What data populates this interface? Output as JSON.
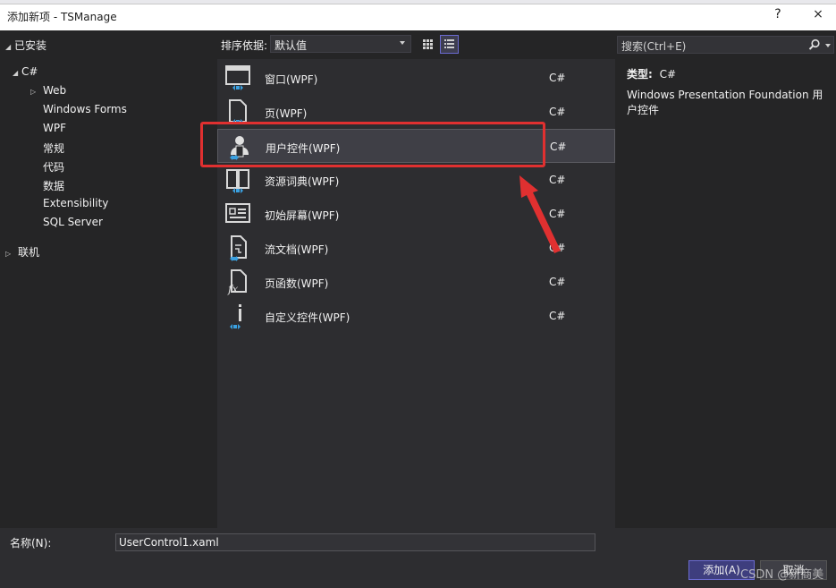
{
  "window": {
    "title": "添加新项 - TSManage",
    "help": "?",
    "close": "×"
  },
  "tree": {
    "installed": "已安装",
    "csharp": "C#",
    "items": [
      "Web",
      "Windows Forms",
      "WPF",
      "常规",
      "代码",
      "数据",
      "Extensibility",
      "SQL Server"
    ],
    "online": "联机"
  },
  "toolbar": {
    "sort_label": "排序依据:",
    "sort_value": "默认值"
  },
  "search": {
    "placeholder": "搜索(Ctrl+E)"
  },
  "templates": [
    {
      "name": "窗口(WPF)",
      "lang": "C#",
      "icon": "wpf-window-icon"
    },
    {
      "name": "页(WPF)",
      "lang": "C#",
      "icon": "wpf-page-icon"
    },
    {
      "name": "用户控件(WPF)",
      "lang": "C#",
      "icon": "wpf-user-control-icon"
    },
    {
      "name": "资源词典(WPF)",
      "lang": "C#",
      "icon": "resource-dictionary-icon"
    },
    {
      "name": "初始屏幕(WPF)",
      "lang": "C#",
      "icon": "splash-screen-icon"
    },
    {
      "name": "流文档(WPF)",
      "lang": "C#",
      "icon": "flow-document-icon"
    },
    {
      "name": "页函数(WPF)",
      "lang": "C#",
      "icon": "page-function-icon"
    },
    {
      "name": "自定义控件(WPF)",
      "lang": "C#",
      "icon": "custom-control-icon"
    }
  ],
  "selected_index": 2,
  "details": {
    "type_label": "类型:",
    "type_value": "C#",
    "description": "Windows Presentation Foundation 用户控件"
  },
  "bottom": {
    "name_label": "名称(N):",
    "name_value": "UserControl1.xaml",
    "add_label": "添加(A)",
    "cancel_label": "取消"
  },
  "watermark": "CSDN @新商美",
  "colors": {
    "accent": "#3e3e7e",
    "annotation": "#e03030"
  }
}
